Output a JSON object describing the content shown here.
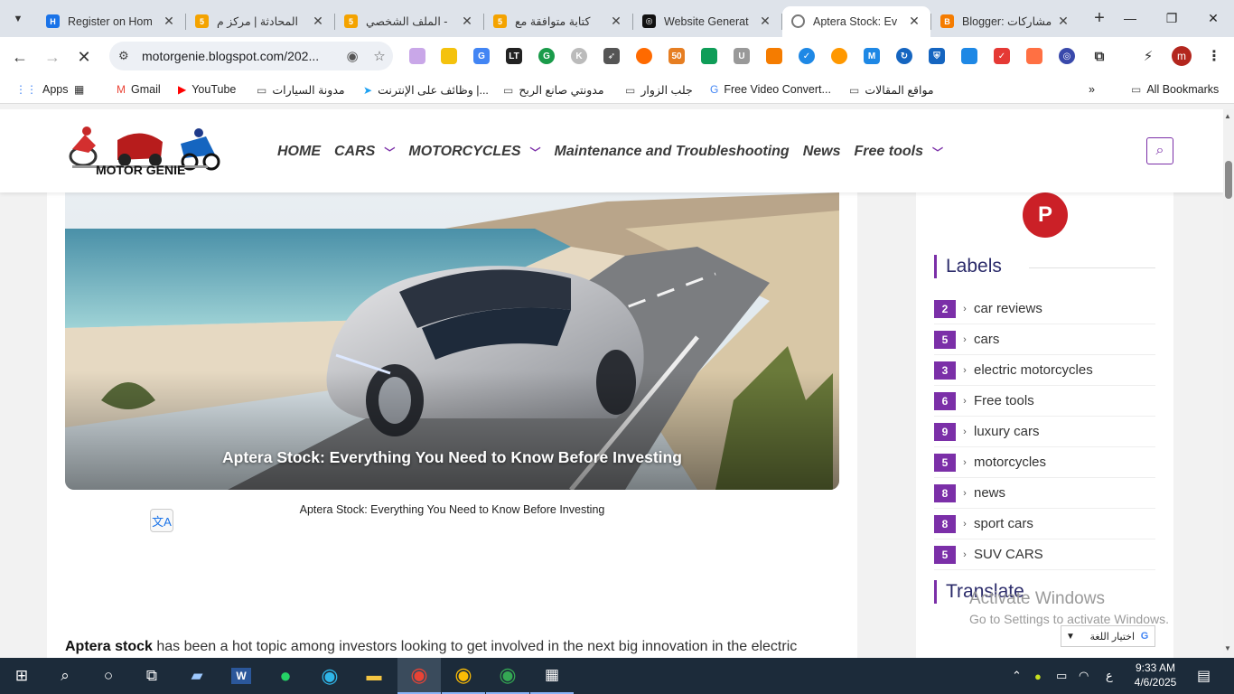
{
  "browser": {
    "tabs": [
      {
        "title": "Register on Hom",
        "fav_color": "#1a73e8",
        "fav_glyph": "H",
        "active": false
      },
      {
        "title": "المحادثة | مركز م",
        "fav_color": "#f4a300",
        "fav_glyph": "5",
        "active": false
      },
      {
        "title": "الملف الشخصي -",
        "fav_color": "#f4a300",
        "fav_glyph": "5",
        "active": false
      },
      {
        "title": "كتابة متوافقة مع",
        "fav_color": "#f4a300",
        "fav_glyph": "5",
        "active": false
      },
      {
        "title": "Website Generat",
        "fav_color": "#111111",
        "fav_glyph": "◎",
        "active": false
      },
      {
        "title": "Aptera Stock: Ev",
        "fav_color": "#ffffff",
        "fav_glyph": "",
        "active": true
      },
      {
        "title": "Blogger: مشاركات",
        "fav_color": "#f57c00",
        "fav_glyph": "B",
        "active": false
      }
    ],
    "url": "motorgenie.blogspot.com/202...",
    "profile_initial": "m",
    "bookmarks": [
      {
        "label": "Apps",
        "icon": "apps-grid-icon"
      },
      {
        "label": "",
        "icon": "grid-icon"
      },
      {
        "label": "Gmail",
        "icon": "gmail-icon"
      },
      {
        "label": "YouTube",
        "icon": "youtube-icon"
      },
      {
        "label": "مدونة السيارات",
        "icon": "folder-icon"
      },
      {
        "label": "وظائف على الإنترنت |...",
        "icon": "bird-icon"
      },
      {
        "label": "مدونتي صانع الربح",
        "icon": "folder-icon"
      },
      {
        "label": "جلب الزوار",
        "icon": "folder-icon"
      },
      {
        "label": "Free Video Convert...",
        "icon": "google-icon"
      },
      {
        "label": "مواقع المقالات",
        "icon": "folder-icon"
      },
      {
        "label": "All Bookmarks",
        "icon": "folder-icon"
      }
    ]
  },
  "site": {
    "logo_text": "MOTOR GENIE",
    "nav": [
      {
        "label": "HOME",
        "dropdown": false
      },
      {
        "label": "CARS",
        "dropdown": true
      },
      {
        "label": "MOTORCYCLES",
        "dropdown": true
      },
      {
        "label": "Maintenance and Troubleshooting",
        "dropdown": false
      },
      {
        "label": "News",
        "dropdown": false
      },
      {
        "label": "Free tools",
        "dropdown": true
      }
    ],
    "accent": "#7b2fa8"
  },
  "article": {
    "hero_caption": "Aptera Stock: Everything You Need to Know Before Investing",
    "image_caption": "Aptera Stock: Everything You Need to Know Before Investing",
    "para_bold": "Aptera stock",
    "para_rest": " has been a hot topic among investors looking to get involved in the next big innovation in the electric"
  },
  "sidebar": {
    "labels_title": "Labels",
    "labels": [
      {
        "count": "2",
        "name": "car reviews"
      },
      {
        "count": "5",
        "name": "cars"
      },
      {
        "count": "3",
        "name": "electric motorcycles"
      },
      {
        "count": "6",
        "name": "Free tools"
      },
      {
        "count": "9",
        "name": "luxury cars"
      },
      {
        "count": "5",
        "name": "motorcycles"
      },
      {
        "count": "8",
        "name": "news"
      },
      {
        "count": "8",
        "name": "sport cars"
      },
      {
        "count": "5",
        "name": "SUV CARS"
      }
    ],
    "translate_title": "Translate",
    "lang_select": "اختيار اللغة"
  },
  "overlay": {
    "activate_title": "Activate Windows",
    "activate_sub": "Go to Settings to activate Windows."
  },
  "taskbar": {
    "time": "9:33 AM",
    "date": "4/6/2025",
    "lang": "ع"
  }
}
